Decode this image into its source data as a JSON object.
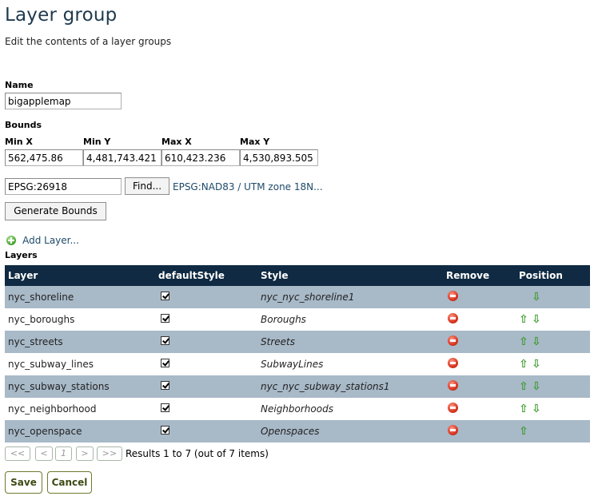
{
  "page": {
    "title": "Layer group",
    "description": "Edit the contents of a layer groups"
  },
  "form": {
    "name_label": "Name",
    "name_value": "bigapplemap",
    "bounds_label": "Bounds",
    "minx_label": "Min X",
    "minx_value": "562,475.86",
    "miny_label": "Min Y",
    "miny_value": "4,481,743.421",
    "maxx_label": "Max X",
    "maxx_value": "610,423.236",
    "maxy_label": "Max Y",
    "maxy_value": "4,530,893.505",
    "crs_value": "EPSG:26918",
    "find_label": "Find...",
    "crs_link": "EPSG:NAD83 / UTM zone 18N...",
    "generate_label": "Generate Bounds",
    "add_layer_label": "Add Layer...",
    "layers_label": "Layers"
  },
  "table": {
    "headers": {
      "layer": "Layer",
      "default_style": "defaultStyle",
      "style": "Style",
      "remove": "Remove",
      "position": "Position"
    },
    "rows": [
      {
        "layer": "nyc_shoreline",
        "style": "nyc_nyc_shoreline1",
        "up": false,
        "down": true
      },
      {
        "layer": "nyc_boroughs",
        "style": "Boroughs",
        "up": true,
        "down": true
      },
      {
        "layer": "nyc_streets",
        "style": "Streets",
        "up": true,
        "down": true
      },
      {
        "layer": "nyc_subway_lines",
        "style": "SubwayLines",
        "up": true,
        "down": true
      },
      {
        "layer": "nyc_subway_stations",
        "style": "nyc_nyc_subway_stations1",
        "up": true,
        "down": true
      },
      {
        "layer": "nyc_neighborhood",
        "style": "Neighborhoods",
        "up": true,
        "down": true
      },
      {
        "layer": "nyc_openspace",
        "style": "Openspaces",
        "up": true,
        "down": false
      }
    ]
  },
  "pager": {
    "first": "<<",
    "prev": "<",
    "page": "1",
    "next": ">",
    "last": ">>",
    "results": "Results 1 to 7 (out of 7 items)"
  },
  "actions": {
    "save": "Save",
    "cancel": "Cancel"
  }
}
